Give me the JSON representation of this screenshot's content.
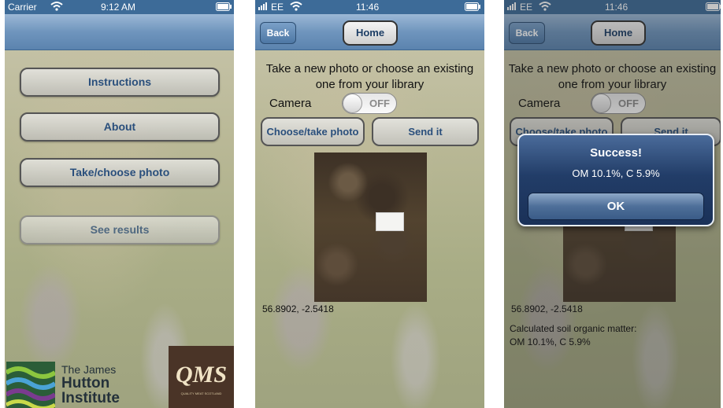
{
  "screen1": {
    "status": {
      "carrier": "Carrier",
      "time": "9:12 AM"
    },
    "menu": [
      "Instructions",
      "About",
      "Take/choose photo",
      "See results"
    ],
    "logo": {
      "line1": "The James",
      "line2": "Hutton",
      "line3": "Institute",
      "qms": "QMS",
      "qms_sub": "QUALITY MEAT SCOTLAND"
    }
  },
  "screen2": {
    "status": {
      "carrier": "EE",
      "time": "11:46"
    },
    "nav": {
      "back": "Back",
      "home": "Home"
    },
    "prompt": "Take a new photo or choose an existing one from your library",
    "camera_label": "Camera",
    "toggle_text": "OFF",
    "choose_btn": "Choose/take photo",
    "send_btn": "Send it",
    "coords": "56.8902, -2.5418"
  },
  "screen3": {
    "status": {
      "carrier": "EE",
      "time": "11:46"
    },
    "nav": {
      "back": "Back",
      "home": "Home"
    },
    "prompt": "Take a new photo or choose an existing one from your library",
    "camera_label": "Camera",
    "toggle_text": "OFF",
    "choose_btn": "Choose/take photo",
    "send_btn": "Send it",
    "coords": "56.8902, -2.5418",
    "result_label": "Calculated soil organic matter:",
    "result_value": "OM 10.1%, C 5.9%",
    "alert": {
      "title": "Success!",
      "message": "OM 10.1%, C 5.9%",
      "ok": "OK"
    }
  },
  "colors": {
    "nav_blue": "#5b83ae",
    "status_blue": "#3d6b98",
    "button_text": "#2a4f7c",
    "alert_blue": "#223d68"
  },
  "icons": [
    "wifi-icon",
    "battery-icon",
    "signal-icon",
    "hutton-logo",
    "qms-logo"
  ]
}
